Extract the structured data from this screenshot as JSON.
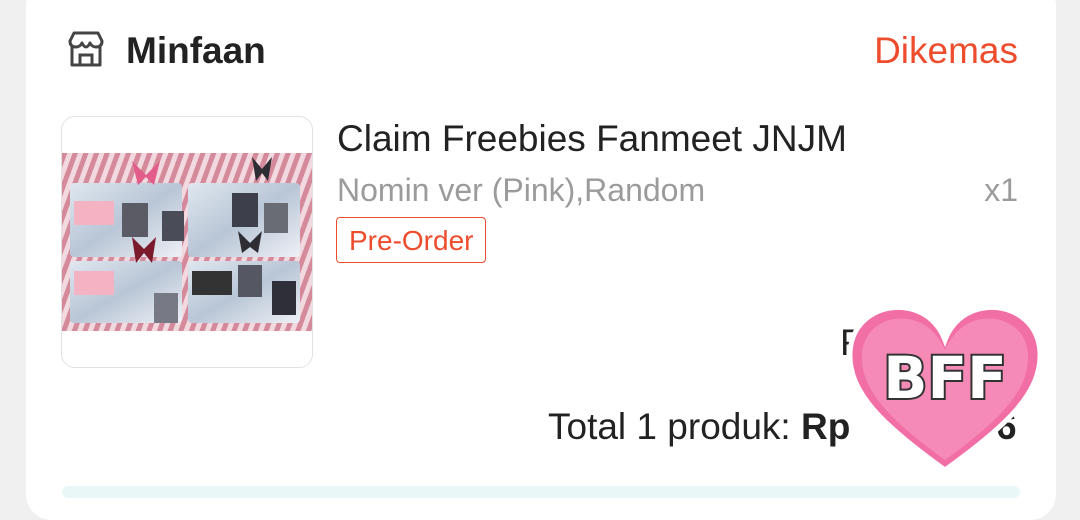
{
  "shop": {
    "name": "Minfaan",
    "icon": "store-icon"
  },
  "order": {
    "status": "Dikemas"
  },
  "product": {
    "title": "Claim Freebies Fanmeet JNJM",
    "variant": "Nomin ver (Pink),Random",
    "quantity": "x1",
    "badge": "Pre-Order",
    "price_partial": "R"
  },
  "total": {
    "label": "Total 1 produk: ",
    "currency": "Rp",
    "value_tail": "6"
  },
  "sticker": {
    "text": "BFF"
  },
  "colors": {
    "accent": "#ee4d2d",
    "muted": "#9b9b9b",
    "sticker_pink": "#f26fa6"
  }
}
